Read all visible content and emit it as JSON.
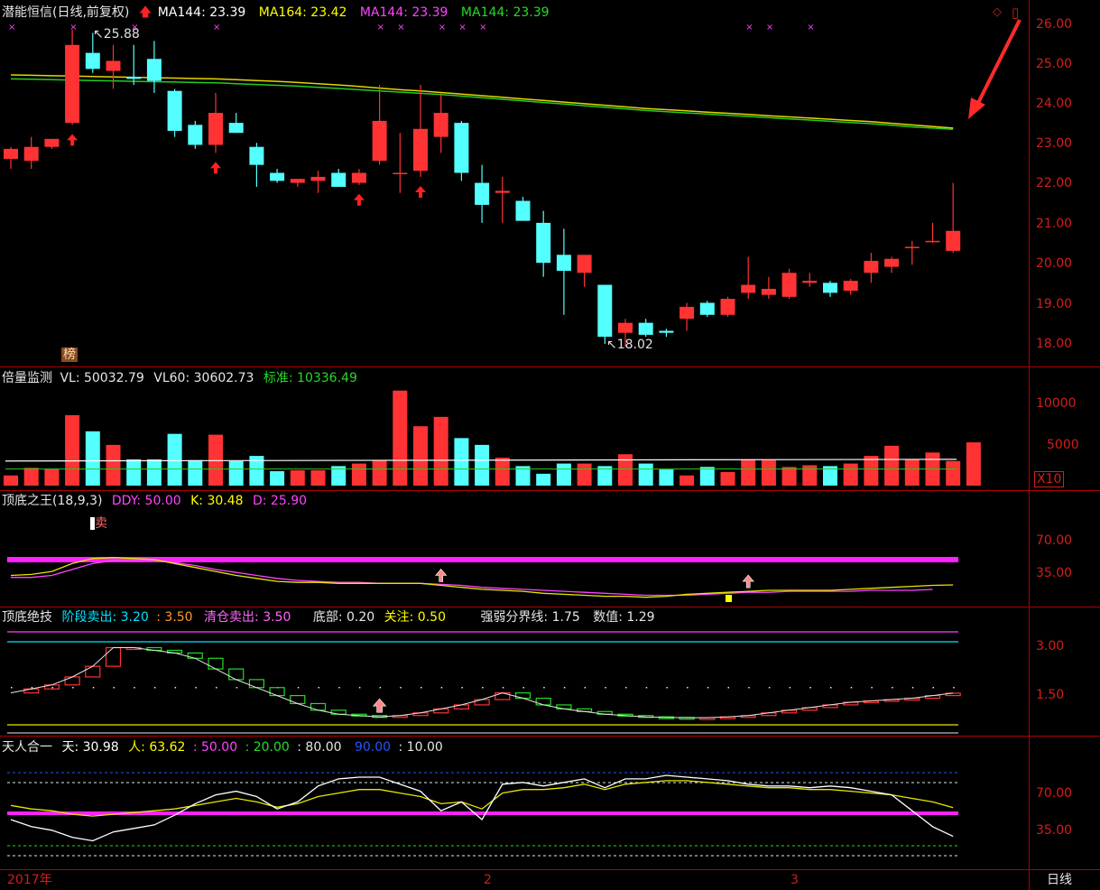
{
  "header": {
    "stock": "潜能恒信(日线,前复权)",
    "ma_items": [
      {
        "text": "MA144: 23.39",
        "color": "#ffffff"
      },
      {
        "text": "MA164: 23.42",
        "color": "#ffff00"
      },
      {
        "text": "MA144: 23.39",
        "color": "#ff44ff"
      },
      {
        "text": "MA144: 23.39",
        "color": "#22dd22"
      }
    ],
    "tag": "榜",
    "high_label": "25.88",
    "low_label": "18.02"
  },
  "volume_header": {
    "title": "倍量监测",
    "vl": "VL: 50032.79",
    "vl60": "VL60: 30602.73",
    "std": "标准: 10336.49",
    "unit": "X10"
  },
  "kdj_header": {
    "title": "顶底之王(18,9,3)",
    "ddy": "DDY: 50.00",
    "k": "K: 30.48",
    "d": "D: 25.90",
    "sell": "卖"
  },
  "tech_header": {
    "title": "顶底绝技",
    "stage_sell": "阶段卖出: 3.20",
    "v350": ": 3.50",
    "clear_sell": "清仓卖出: 3.50",
    "bottom": "底部: 0.20",
    "focus": "关注: 0.50",
    "divide": "强弱分界线: 1.75",
    "value": "数值: 1.29"
  },
  "tr_header": {
    "title": "天人合一",
    "tian": "天: 30.98",
    "ren": "人: 63.62",
    "v1": ": 50.00",
    "v2": ": 20.00",
    "v3": ": 80.00",
    "v4": "90.00",
    "v5": ": 10.00"
  },
  "axes": {
    "price_ticks": [
      "26.00",
      "25.00",
      "24.00",
      "23.00",
      "22.00",
      "21.00",
      "20.00",
      "19.00",
      "18.00"
    ],
    "vol_ticks": [
      "10000",
      "5000"
    ],
    "kdj_ticks": [
      "70.00",
      "35.00"
    ],
    "tech_ticks": [
      "3.00",
      "1.50"
    ],
    "tr_ticks": [
      "70.00",
      "35.00"
    ],
    "date_labels": [
      "2017年",
      "2",
      "3"
    ],
    "period": "日线"
  },
  "colors": {
    "up": "#ff3333",
    "down": "#54ffff",
    "grid": "#b00000",
    "axis_text": "#d21e1e"
  },
  "chart_data": {
    "type": "candlestick",
    "ylim": [
      17.8,
      26.3
    ],
    "candles": [
      {
        "o": 22.65,
        "h": 22.95,
        "l": 22.4,
        "c": 22.9
      },
      {
        "o": 22.6,
        "h": 23.2,
        "l": 22.4,
        "c": 22.95
      },
      {
        "o": 22.95,
        "h": 23.15,
        "l": 22.9,
        "c": 23.15
      },
      {
        "o": 23.55,
        "h": 25.88,
        "l": 23.5,
        "c": 25.5
      },
      {
        "o": 25.3,
        "h": 25.8,
        "l": 24.8,
        "c": 24.9
      },
      {
        "o": 24.85,
        "h": 25.5,
        "l": 24.4,
        "c": 25.1
      },
      {
        "o": 24.7,
        "h": 25.5,
        "l": 24.5,
        "c": 24.65
      },
      {
        "o": 25.15,
        "h": 25.6,
        "l": 24.3,
        "c": 24.6
      },
      {
        "o": 24.35,
        "h": 24.4,
        "l": 23.2,
        "c": 23.35
      },
      {
        "o": 23.5,
        "h": 23.6,
        "l": 22.9,
        "c": 23.0
      },
      {
        "o": 23.0,
        "h": 24.3,
        "l": 22.8,
        "c": 23.8
      },
      {
        "o": 23.55,
        "h": 23.8,
        "l": 23.3,
        "c": 23.3
      },
      {
        "o": 22.95,
        "h": 23.05,
        "l": 21.95,
        "c": 22.5
      },
      {
        "o": 22.3,
        "h": 22.4,
        "l": 22.05,
        "c": 22.1
      },
      {
        "o": 22.05,
        "h": 22.15,
        "l": 21.95,
        "c": 22.15
      },
      {
        "o": 22.1,
        "h": 22.35,
        "l": 21.8,
        "c": 22.2
      },
      {
        "o": 22.3,
        "h": 22.4,
        "l": 21.95,
        "c": 21.95
      },
      {
        "o": 22.05,
        "h": 22.4,
        "l": 22.0,
        "c": 22.3
      },
      {
        "o": 22.6,
        "h": 24.5,
        "l": 22.5,
        "c": 23.6
      },
      {
        "o": 22.3,
        "h": 23.3,
        "l": 21.8,
        "c": 22.3
      },
      {
        "o": 22.35,
        "h": 24.5,
        "l": 22.2,
        "c": 23.4
      },
      {
        "o": 23.2,
        "h": 24.3,
        "l": 22.8,
        "c": 23.8
      },
      {
        "o": 23.55,
        "h": 23.6,
        "l": 22.1,
        "c": 22.3
      },
      {
        "o": 22.05,
        "h": 22.5,
        "l": 21.05,
        "c": 21.5
      },
      {
        "o": 21.8,
        "h": 22.2,
        "l": 21.05,
        "c": 21.85
      },
      {
        "o": 21.6,
        "h": 21.7,
        "l": 21.1,
        "c": 21.1
      },
      {
        "o": 21.05,
        "h": 21.35,
        "l": 19.7,
        "c": 20.05
      },
      {
        "o": 20.25,
        "h": 20.9,
        "l": 18.75,
        "c": 19.85
      },
      {
        "o": 19.8,
        "h": 19.95,
        "l": 19.45,
        "c": 20.25
      },
      {
        "o": 19.5,
        "h": 19.5,
        "l": 18.02,
        "c": 18.2
      },
      {
        "o": 18.3,
        "h": 18.65,
        "l": 17.95,
        "c": 18.55
      },
      {
        "o": 18.55,
        "h": 18.65,
        "l": 18.2,
        "c": 18.25
      },
      {
        "o": 18.35,
        "h": 18.4,
        "l": 18.2,
        "c": 18.3
      },
      {
        "o": 18.65,
        "h": 19.05,
        "l": 18.35,
        "c": 18.95
      },
      {
        "o": 19.05,
        "h": 19.1,
        "l": 18.7,
        "c": 18.75
      },
      {
        "o": 18.75,
        "h": 19.2,
        "l": 18.7,
        "c": 19.15
      },
      {
        "o": 19.3,
        "h": 20.2,
        "l": 19.15,
        "c": 19.5
      },
      {
        "o": 19.25,
        "h": 19.7,
        "l": 19.15,
        "c": 19.4
      },
      {
        "o": 19.2,
        "h": 19.9,
        "l": 19.15,
        "c": 19.8
      },
      {
        "o": 19.55,
        "h": 19.8,
        "l": 19.45,
        "c": 19.6
      },
      {
        "o": 19.55,
        "h": 19.6,
        "l": 19.2,
        "c": 19.3
      },
      {
        "o": 19.35,
        "h": 19.65,
        "l": 19.25,
        "c": 19.6
      },
      {
        "o": 19.8,
        "h": 20.3,
        "l": 19.55,
        "c": 20.1
      },
      {
        "o": 19.95,
        "h": 20.2,
        "l": 19.8,
        "c": 20.15
      },
      {
        "o": 20.45,
        "h": 20.6,
        "l": 20.0,
        "c": 20.45
      },
      {
        "o": 20.6,
        "h": 21.05,
        "l": 20.55,
        "c": 20.6
      },
      {
        "o": 20.35,
        "h": 22.05,
        "l": 20.3,
        "c": 20.85
      }
    ],
    "ma_white": [
      24.65,
      24.64,
      24.63,
      24.62,
      24.61,
      24.6,
      24.59,
      24.58,
      24.57,
      24.56,
      24.55,
      24.53,
      24.51,
      24.49,
      24.47,
      24.44,
      24.41,
      24.38,
      24.35,
      24.32,
      24.29,
      24.26,
      24.22,
      24.18,
      24.14,
      24.1,
      24.06,
      24.02,
      23.98,
      23.94,
      23.9,
      23.86,
      23.83,
      23.8,
      23.77,
      23.74,
      23.71,
      23.68,
      23.65,
      23.62,
      23.59,
      23.56,
      23.53,
      23.49,
      23.45,
      23.42,
      23.39
    ],
    "ma_yellow": [
      24.75,
      24.74,
      24.73,
      24.72,
      24.71,
      24.7,
      24.69,
      24.68,
      24.67,
      24.66,
      24.65,
      24.63,
      24.61,
      24.59,
      24.56,
      24.53,
      24.5,
      24.46,
      24.42,
      24.38,
      24.35,
      24.31,
      24.27,
      24.23,
      24.19,
      24.15,
      24.11,
      24.07,
      24.03,
      23.99,
      23.95,
      23.91,
      23.88,
      23.85,
      23.82,
      23.79,
      23.76,
      23.73,
      23.7,
      23.67,
      23.64,
      23.61,
      23.58,
      23.54,
      23.5,
      23.46,
      23.42
    ],
    "volume": [
      1200,
      2100,
      2000,
      8300,
      6400,
      4800,
      3100,
      3100,
      6100,
      3000,
      6000,
      2900,
      3500,
      1700,
      1800,
      1800,
      2300,
      2600,
      3000,
      11200,
      7000,
      8100,
      5600,
      4800,
      3300,
      2300,
      1400,
      2600,
      2600,
      2300,
      3700,
      2600,
      1900,
      1200,
      2200,
      1600,
      3100,
      3000,
      2200,
      2400,
      2300,
      2600,
      3500,
      4700,
      3100,
      3900,
      2900,
      5100
    ],
    "kdj_k": [
      40,
      41,
      44,
      52,
      57,
      58,
      57,
      56,
      52,
      48,
      44,
      40,
      37,
      34,
      33,
      33,
      32,
      32,
      32,
      32,
      32,
      30,
      28,
      26,
      25,
      24,
      22,
      21,
      20,
      19,
      19,
      18,
      19,
      21,
      22,
      23,
      24,
      25,
      25,
      25,
      25,
      26,
      27,
      28,
      29,
      30,
      30.48
    ],
    "kdj_d": [
      38,
      38,
      40,
      46,
      52,
      55,
      55,
      55,
      53,
      50,
      46,
      43,
      40,
      37,
      35,
      34,
      33,
      33,
      32,
      32,
      32,
      31,
      30,
      28,
      27,
      26,
      25,
      24,
      23,
      22,
      21,
      20,
      20,
      20,
      21,
      22,
      23,
      23,
      24,
      24,
      24,
      24,
      25,
      25,
      25,
      25.9
    ],
    "tech_val": [
      1.3,
      1.45,
      1.6,
      1.9,
      2.3,
      3.0,
      3.0,
      2.9,
      2.8,
      2.6,
      2.2,
      1.8,
      1.5,
      1.2,
      0.9,
      0.65,
      0.5,
      0.45,
      0.4,
      0.45,
      0.55,
      0.7,
      0.85,
      1.05,
      1.3,
      1.1,
      0.85,
      0.7,
      0.6,
      0.5,
      0.45,
      0.4,
      0.38,
      0.37,
      0.37,
      0.4,
      0.45,
      0.55,
      0.65,
      0.75,
      0.85,
      0.95,
      1.0,
      1.05,
      1.1,
      1.2,
      1.29
    ],
    "tr_tian": [
      50,
      42,
      38,
      30,
      26,
      36,
      40,
      44,
      55,
      68,
      78,
      82,
      76,
      62,
      70,
      88,
      96,
      98,
      98,
      90,
      82,
      60,
      70,
      50,
      90,
      92,
      88,
      92,
      96,
      86,
      96,
      96,
      100,
      98,
      96,
      94,
      90,
      88,
      88,
      86,
      88,
      86,
      82,
      78,
      60,
      42,
      30.98
    ],
    "tr_ren": [
      66,
      62,
      60,
      56,
      54,
      56,
      58,
      60,
      62,
      66,
      70,
      74,
      70,
      64,
      68,
      76,
      80,
      84,
      84,
      80,
      76,
      68,
      70,
      62,
      80,
      84,
      84,
      86,
      90,
      84,
      90,
      92,
      94,
      94,
      92,
      90,
      88,
      86,
      86,
      84,
      84,
      82,
      80,
      78,
      74,
      70,
      63.62
    ]
  }
}
